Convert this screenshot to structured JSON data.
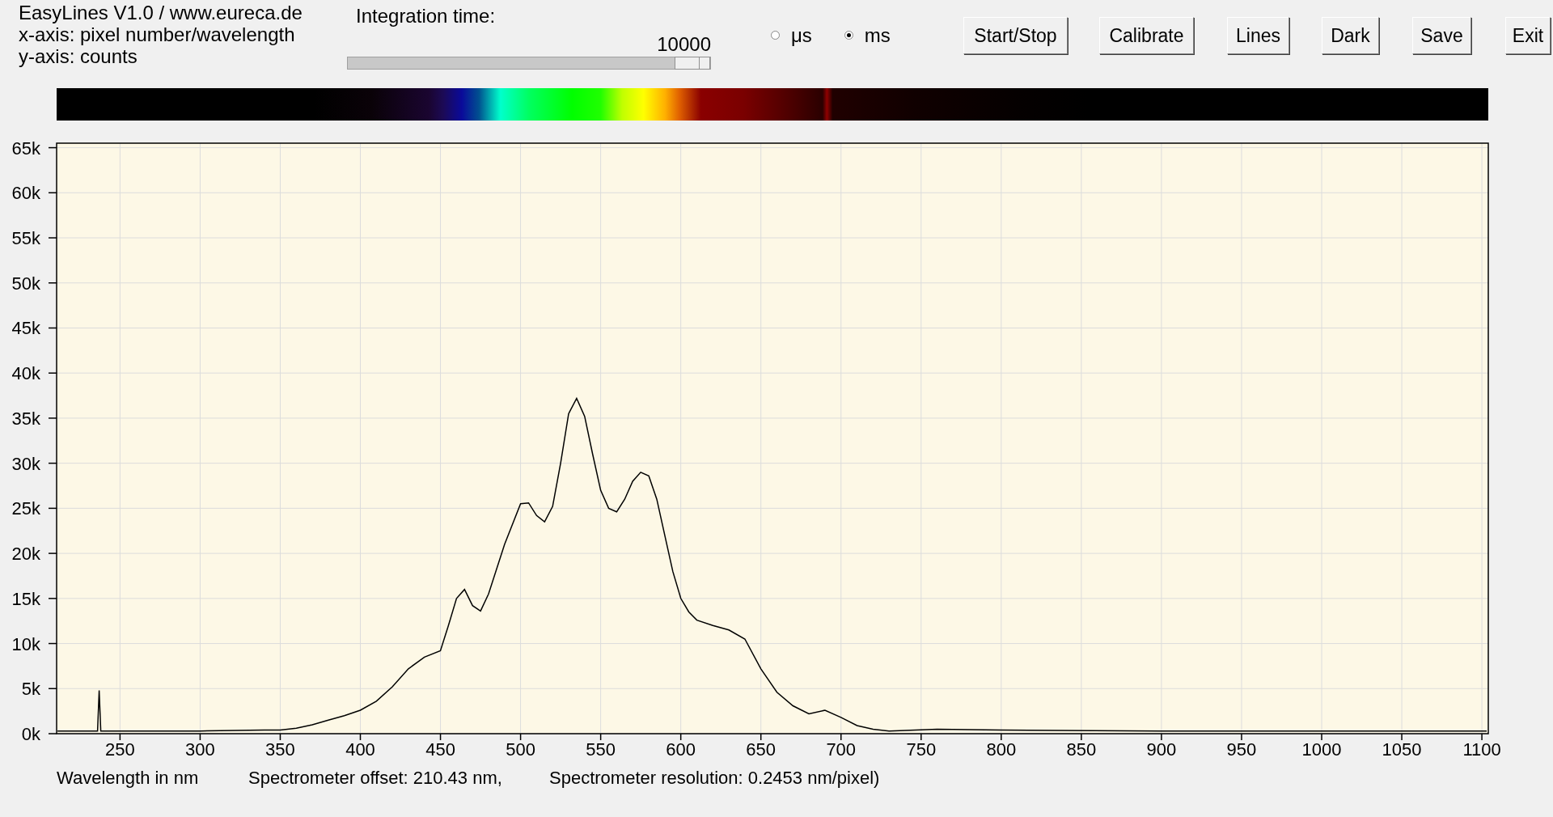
{
  "info_lines": [
    "EasyLines V1.0 / www.eureca.de",
    "x-axis: pixel number/wavelength",
    "y-axis: counts"
  ],
  "integration": {
    "label": "Integration time:",
    "value": "10000",
    "level": 1
  },
  "units": [
    {
      "label": "μs",
      "selected": false
    },
    {
      "label": "ms",
      "selected": true
    }
  ],
  "buttons": [
    "Start/Stop",
    "Calibrate",
    "Lines",
    "Dark",
    "Save",
    "Exit"
  ],
  "chart_data": {
    "type": "line",
    "grid": true,
    "xlabel": "Wavelength in nm",
    "xlim": [
      210.43,
      1104
    ],
    "ylim": [
      0,
      65500
    ],
    "xticks": [
      250,
      300,
      350,
      400,
      450,
      500,
      550,
      600,
      650,
      700,
      750,
      800,
      850,
      900,
      950,
      1000,
      1050,
      1100
    ],
    "yticks": [
      {
        "value": 0,
        "label": "0k"
      },
      {
        "value": 5000,
        "label": "5k"
      },
      {
        "value": 10000,
        "label": "10k"
      },
      {
        "value": 15000,
        "label": "15k"
      },
      {
        "value": 20000,
        "label": "20k"
      },
      {
        "value": 25000,
        "label": "25k"
      },
      {
        "value": 30000,
        "label": "30k"
      },
      {
        "value": 35000,
        "label": "35k"
      },
      {
        "value": 40000,
        "label": "40k"
      },
      {
        "value": 45000,
        "label": "45k"
      },
      {
        "value": 50000,
        "label": "50k"
      },
      {
        "value": 55000,
        "label": "55k"
      },
      {
        "value": 60000,
        "label": "60k"
      },
      {
        "value": 65000,
        "label": "65k"
      }
    ],
    "x": [
      211,
      236,
      237,
      238,
      260,
      300,
      340,
      350,
      360,
      370,
      380,
      390,
      400,
      410,
      420,
      430,
      440,
      450,
      455,
      460,
      465,
      470,
      475,
      480,
      490,
      500,
      505,
      510,
      515,
      520,
      525,
      530,
      535,
      540,
      545,
      550,
      555,
      560,
      565,
      570,
      575,
      580,
      585,
      590,
      595,
      600,
      605,
      610,
      620,
      630,
      640,
      650,
      660,
      670,
      680,
      690,
      700,
      710,
      720,
      730,
      760,
      800,
      900,
      1000,
      1103
    ],
    "series": [
      {
        "color": "#000000",
        "values": [
          300,
          300,
          4800,
          300,
          300,
          300,
          400,
          400,
          600,
          1000,
          1500,
          2000,
          2600,
          3600,
          5200,
          7200,
          8500,
          9200,
          12000,
          15000,
          16000,
          14200,
          13600,
          15500,
          21000,
          25500,
          25600,
          24200,
          23500,
          25200,
          30000,
          35500,
          37200,
          35200,
          31000,
          27000,
          25000,
          24600,
          26000,
          28000,
          29000,
          28600,
          26000,
          22000,
          18000,
          15000,
          13500,
          12600,
          12000,
          11500,
          10500,
          7200,
          4600,
          3100,
          2200,
          2600,
          1800,
          900,
          500,
          300,
          500,
          400,
          300,
          300,
          300
        ]
      }
    ]
  },
  "footer": [
    "Spectrometer offset: 210.43 nm,",
    "Spectrometer resolution: 0.2453 nm/pixel)"
  ]
}
